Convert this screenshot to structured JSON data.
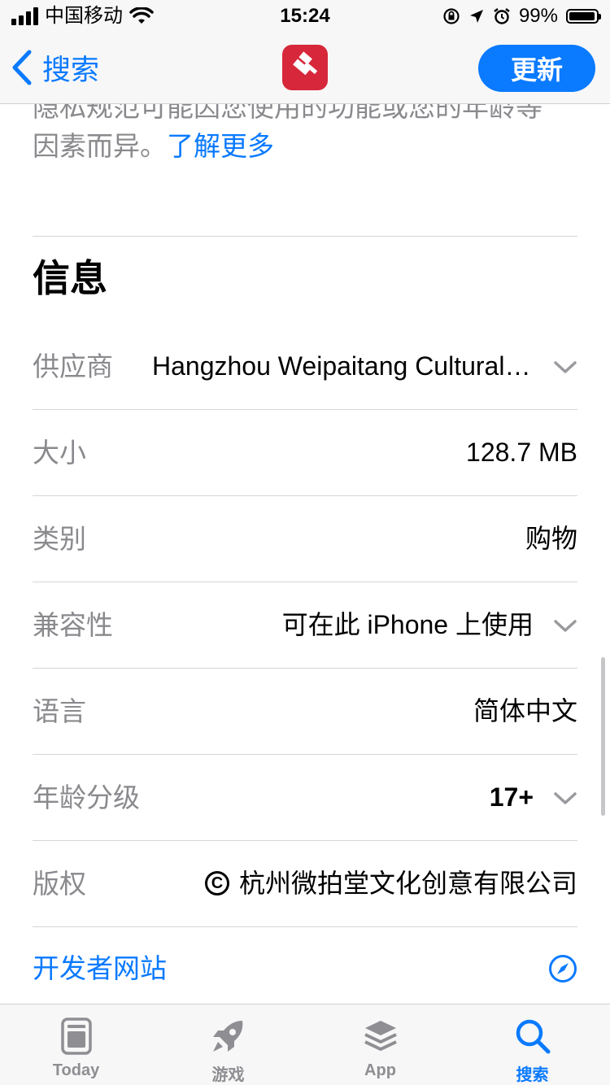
{
  "status_bar": {
    "carrier": "中国移动",
    "time": "15:24",
    "battery_percent": "99%"
  },
  "nav": {
    "back_label": "搜索",
    "update_label": "更新",
    "app_icon": "hammer-gavel-icon"
  },
  "privacy": {
    "line1": "隐私规范可能因您使用的功能或您的年龄等",
    "line2": "因素而异。",
    "learn_more": "了解更多"
  },
  "info": {
    "title": "信息",
    "rows": [
      {
        "label": "供应商",
        "value": "Hangzhou Weipaitang Cultural Creativity Co., Ltd."
      },
      {
        "label": "大小",
        "value": "128.7 MB"
      },
      {
        "label": "类别",
        "value": "购物"
      },
      {
        "label": "兼容性",
        "value": "可在此 iPhone 上使用"
      },
      {
        "label": "语言",
        "value": "简体中文"
      },
      {
        "label": "年龄分级",
        "value": "17+"
      },
      {
        "label": "版权",
        "value": "杭州微拍堂文化创意有限公司"
      }
    ],
    "developer_site": "开发者网站"
  },
  "tab_bar": {
    "tabs": [
      {
        "label": "Today",
        "icon": "today-icon"
      },
      {
        "label": "游戏",
        "icon": "rocket-icon"
      },
      {
        "label": "App",
        "icon": "layers-icon"
      },
      {
        "label": "搜索",
        "icon": "search-icon"
      }
    ],
    "active_tab": "搜索"
  },
  "colors": {
    "accent": "#0a7aff",
    "app_icon_bg": "#d7273a",
    "secondary_text": "#8a8a8e"
  }
}
